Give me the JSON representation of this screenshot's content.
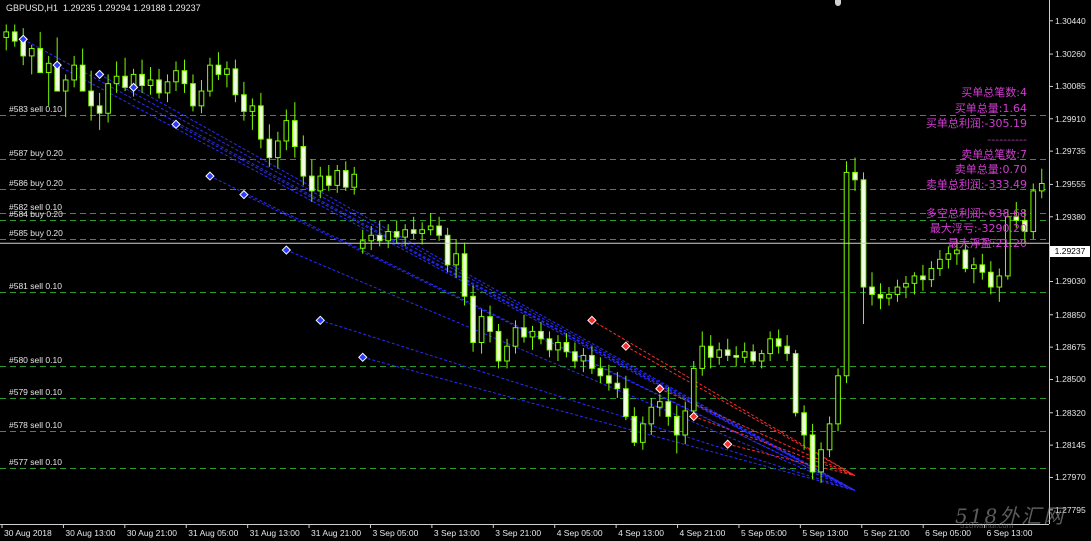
{
  "header": {
    "text": "GBPUSD,H1  1.29235 1.29294 1.29188 1.29237"
  },
  "price_axis": {
    "labels": [
      "1.30440",
      "1.30260",
      "1.30085",
      "1.29910",
      "1.29735",
      "1.29555",
      "1.29380",
      "1.29205",
      "1.29030",
      "1.28850",
      "1.28675",
      "1.28500",
      "1.28320",
      "1.28145",
      "1.27970",
      "1.27795"
    ],
    "current": "1.29237"
  },
  "time_axis": {
    "labels": [
      "30 Aug 2018",
      "30 Aug 13:00",
      "30 Aug 21:00",
      "31 Aug 05:00",
      "31 Aug 13:00",
      "31 Aug 21:00",
      "3 Sep 05:00",
      "3 Sep 13:00",
      "3 Sep 21:00",
      "4 Sep 05:00",
      "4 Sep 13:00",
      "4 Sep 21:00",
      "5 Sep 05:00",
      "5 Sep 13:00",
      "5 Sep 21:00",
      "6 Sep 05:00",
      "6 Sep 13:00"
    ]
  },
  "order_lines": [
    {
      "label": "#583 sell 0.10",
      "price": 1.2993
    },
    {
      "label": "#587 buy 0.20",
      "price": 1.29695
    },
    {
      "label": "#586 buy 0.20",
      "price": 1.2953
    },
    {
      "label": "#582 sell 0.10",
      "price": 1.294
    },
    {
      "label": "#584 buy 0.20",
      "price": 1.2936
    },
    {
      "label": "#585 buy 0.20",
      "price": 1.2926
    },
    {
      "label": "#581 sell 0.10",
      "price": 1.28975
    },
    {
      "label": "#580 sell 0.10",
      "price": 1.28575
    },
    {
      "label": "#579 sell 0.10",
      "price": 1.284
    },
    {
      "label": "#578 sell 0.10",
      "price": 1.2822
    },
    {
      "label": "#577 sell 0.10",
      "price": 1.2802
    }
  ],
  "stats": {
    "buy_count": "买单总笔数:4",
    "buy_volume": "买单总量:1.64",
    "buy_profit": "买单总利润:-305.19",
    "separator": "----------",
    "sell_count": "卖单总笔数:7",
    "sell_volume": "卖单总量:0.70",
    "sell_profit": "卖单总利润:-333.49",
    "net_profit": "多空总利润:-638.68",
    "max_floating_loss": "最大浮亏:-3290.20",
    "max_floating_profit": "最大浮盈:21.20"
  },
  "watermark": {
    "main": "518外汇网",
    "sub": "518waihui.com"
  },
  "colors": {
    "background": "#000000",
    "bull_candle": "#000000",
    "bull_outline": "#7cfc00",
    "bear_candle": "#f0ffe0",
    "order_line": "#2e9a2e",
    "stats_text": "#d23cd2",
    "buy_marker": "#2a3cff",
    "sell_marker": "#ff2a2a",
    "buy_link": "#2a2aff",
    "sell_link": "#ff2a2a"
  },
  "chart_data": {
    "type": "candlestick",
    "symbol": "GBPUSD",
    "timeframe": "H1",
    "ylim": [
      1.2774,
      1.3052
    ],
    "candles": [
      [
        1.3035,
        1.3042,
        1.3028,
        1.3038
      ],
      [
        1.3038,
        1.3042,
        1.303,
        1.3033
      ],
      [
        1.3033,
        1.304,
        1.302,
        1.3025
      ],
      [
        1.3025,
        1.3031,
        1.3015,
        1.3029
      ],
      [
        1.3029,
        1.3038,
        1.3022,
        1.3016
      ],
      [
        1.3016,
        1.3025,
        1.2998,
        1.3021
      ],
      [
        1.3021,
        1.3035,
        1.301,
        1.3006
      ],
      [
        1.3006,
        1.3015,
        1.2992,
        1.3012
      ],
      [
        1.3012,
        1.3025,
        1.3008,
        1.302
      ],
      [
        1.302,
        1.3029,
        1.3015,
        1.3006
      ],
      [
        1.3006,
        1.3017,
        1.299,
        1.2998
      ],
      [
        1.2998,
        1.3005,
        1.2985,
        1.2994
      ],
      [
        1.2994,
        1.3015,
        1.2989,
        1.301
      ],
      [
        1.301,
        1.3022,
        1.3005,
        1.3014
      ],
      [
        1.3014,
        1.3024,
        1.3006,
        1.3008
      ],
      [
        1.3008,
        1.3018,
        1.3003,
        1.3015
      ],
      [
        1.3015,
        1.3023,
        1.3005,
        1.3009
      ],
      [
        1.3009,
        1.3019,
        1.3004,
        1.3012
      ],
      [
        1.3012,
        1.3018,
        1.3002,
        1.3005
      ],
      [
        1.3005,
        1.3015,
        1.3,
        1.3011
      ],
      [
        1.3011,
        1.3022,
        1.3006,
        1.3017
      ],
      [
        1.3017,
        1.3023,
        1.3005,
        1.301
      ],
      [
        1.301,
        1.3015,
        1.2995,
        1.2998
      ],
      [
        1.2998,
        1.3012,
        1.2994,
        1.3006
      ],
      [
        1.3006,
        1.3024,
        1.3003,
        1.302
      ],
      [
        1.302,
        1.3027,
        1.3012,
        1.3015
      ],
      [
        1.3015,
        1.3022,
        1.3008,
        1.3018
      ],
      [
        1.3018,
        1.3023,
        1.3,
        1.3004
      ],
      [
        1.3004,
        1.3011,
        1.299,
        1.2995
      ],
      [
        1.2995,
        1.3002,
        1.2985,
        1.2998
      ],
      [
        1.2998,
        1.3005,
        1.2975,
        1.298
      ],
      [
        1.298,
        1.2988,
        1.2965,
        1.297
      ],
      [
        1.297,
        1.2984,
        1.2964,
        1.2979
      ],
      [
        1.2979,
        1.2996,
        1.2974,
        1.299
      ],
      [
        1.299,
        1.3,
        1.297,
        1.2976
      ],
      [
        1.2976,
        1.2982,
        1.2955,
        1.296
      ],
      [
        1.296,
        1.2969,
        1.2946,
        1.2952
      ],
      [
        1.2952,
        1.2965,
        1.2948,
        1.296
      ],
      [
        1.296,
        1.2966,
        1.2952,
        1.2955
      ],
      [
        1.2955,
        1.2966,
        1.2951,
        1.2963
      ],
      [
        1.2963,
        1.2968,
        1.2952,
        1.2954
      ],
      [
        1.2954,
        1.2965,
        1.295,
        1.2961
      ],
      [
        1.2921,
        1.2931,
        1.2918,
        1.2925
      ],
      [
        1.2925,
        1.2933,
        1.292,
        1.2928
      ],
      [
        1.2928,
        1.2936,
        1.2922,
        1.2925
      ],
      [
        1.2925,
        1.2934,
        1.2921,
        1.293
      ],
      [
        1.293,
        1.2936,
        1.2924,
        1.2927
      ],
      [
        1.2927,
        1.2934,
        1.2922,
        1.2931
      ],
      [
        1.2931,
        1.2938,
        1.2926,
        1.2929
      ],
      [
        1.2929,
        1.2935,
        1.2923,
        1.2931
      ],
      [
        1.2931,
        1.294,
        1.2928,
        1.2933
      ],
      [
        1.2933,
        1.2938,
        1.2925,
        1.2928
      ],
      [
        1.2928,
        1.2932,
        1.2908,
        1.2912
      ],
      [
        1.2912,
        1.2926,
        1.2905,
        1.2918
      ],
      [
        1.2918,
        1.2924,
        1.289,
        1.2895
      ],
      [
        1.2895,
        1.2901,
        1.2865,
        1.287
      ],
      [
        1.287,
        1.2888,
        1.2864,
        1.2884
      ],
      [
        1.2884,
        1.289,
        1.287,
        1.2876
      ],
      [
        1.2876,
        1.288,
        1.2856,
        1.286
      ],
      [
        1.286,
        1.2872,
        1.2856,
        1.2868
      ],
      [
        1.2868,
        1.2882,
        1.2864,
        1.2878
      ],
      [
        1.2878,
        1.2885,
        1.287,
        1.2873
      ],
      [
        1.2873,
        1.2879,
        1.2866,
        1.2876
      ],
      [
        1.2876,
        1.2881,
        1.2869,
        1.2872
      ],
      [
        1.2872,
        1.2876,
        1.2862,
        1.2866
      ],
      [
        1.2866,
        1.2874,
        1.286,
        1.287
      ],
      [
        1.287,
        1.2875,
        1.2862,
        1.2865
      ],
      [
        1.2865,
        1.287,
        1.2856,
        1.286
      ],
      [
        1.286,
        1.2867,
        1.2854,
        1.2863
      ],
      [
        1.2863,
        1.2868,
        1.2853,
        1.2856
      ],
      [
        1.2856,
        1.2862,
        1.2848,
        1.2852
      ],
      [
        1.2852,
        1.2858,
        1.2844,
        1.2848
      ],
      [
        1.2848,
        1.2854,
        1.284,
        1.2845
      ],
      [
        1.2845,
        1.2852,
        1.2828,
        1.283
      ],
      [
        1.283,
        1.2835,
        1.2814,
        1.2816
      ],
      [
        1.2816,
        1.283,
        1.2812,
        1.2826
      ],
      [
        1.2826,
        1.284,
        1.282,
        1.2835
      ],
      [
        1.2835,
        1.2842,
        1.283,
        1.2838
      ],
      [
        1.2838,
        1.2846,
        1.2825,
        1.283
      ],
      [
        1.283,
        1.2836,
        1.281,
        1.282
      ],
      [
        1.282,
        1.2838,
        1.2815,
        1.2833
      ],
      [
        1.2833,
        1.286,
        1.2829,
        1.2856
      ],
      [
        1.2856,
        1.2876,
        1.2852,
        1.2868
      ],
      [
        1.2868,
        1.2874,
        1.2856,
        1.2862
      ],
      [
        1.2862,
        1.287,
        1.2858,
        1.2866
      ],
      [
        1.2866,
        1.2872,
        1.286,
        1.2863
      ],
      [
        1.2863,
        1.2868,
        1.2857,
        1.2862
      ],
      [
        1.2862,
        1.287,
        1.2859,
        1.2865
      ],
      [
        1.2865,
        1.2869,
        1.2858,
        1.286
      ],
      [
        1.286,
        1.2866,
        1.2856,
        1.2864
      ],
      [
        1.2864,
        1.2876,
        1.286,
        1.2872
      ],
      [
        1.2872,
        1.2877,
        1.2864,
        1.2868
      ],
      [
        1.2868,
        1.2874,
        1.286,
        1.2864
      ],
      [
        1.2864,
        1.2866,
        1.283,
        1.2832
      ],
      [
        1.2832,
        1.2836,
        1.2812,
        1.282
      ],
      [
        1.282,
        1.2826,
        1.2796,
        1.28
      ],
      [
        1.28,
        1.2816,
        1.2794,
        1.2812
      ],
      [
        1.2812,
        1.283,
        1.2808,
        1.2826
      ],
      [
        1.2826,
        1.2856,
        1.2822,
        1.2852
      ],
      [
        1.2852,
        1.2968,
        1.2848,
        1.2962
      ],
      [
        1.2962,
        1.297,
        1.2952,
        1.2958
      ],
      [
        1.2958,
        1.2962,
        1.288,
        1.29
      ],
      [
        1.29,
        1.2908,
        1.289,
        1.2896
      ],
      [
        1.2896,
        1.2902,
        1.2888,
        1.2894
      ],
      [
        1.2894,
        1.29,
        1.289,
        1.2896
      ],
      [
        1.2896,
        1.2904,
        1.2892,
        1.29
      ],
      [
        1.29,
        1.2906,
        1.2894,
        1.2902
      ],
      [
        1.2902,
        1.2908,
        1.2896,
        1.2906
      ],
      [
        1.2906,
        1.2912,
        1.2898,
        1.2904
      ],
      [
        1.2904,
        1.2914,
        1.29,
        1.291
      ],
      [
        1.291,
        1.292,
        1.2906,
        1.2915
      ],
      [
        1.2915,
        1.2922,
        1.291,
        1.2918
      ],
      [
        1.2918,
        1.2926,
        1.2912,
        1.292
      ],
      [
        1.292,
        1.2924,
        1.2908,
        1.291
      ],
      [
        1.291,
        1.2916,
        1.2902,
        1.2912
      ],
      [
        1.2912,
        1.2918,
        1.2904,
        1.2908
      ],
      [
        1.2908,
        1.2914,
        1.2896,
        1.29
      ],
      [
        1.29,
        1.291,
        1.2892,
        1.2906
      ],
      [
        1.2906,
        1.2942,
        1.2904,
        1.2938
      ],
      [
        1.2938,
        1.2946,
        1.2932,
        1.2936
      ],
      [
        1.2936,
        1.2942,
        1.2924,
        1.293
      ],
      [
        1.293,
        1.2956,
        1.2926,
        1.2952
      ],
      [
        1.2952,
        1.2964,
        1.2948,
        1.2956
      ]
    ],
    "trade_markers": [
      {
        "side": "buy",
        "open": 1.3034,
        "close": 1.279
      },
      {
        "side": "buy",
        "open": 1.302,
        "close": 1.279
      },
      {
        "side": "buy",
        "open": 1.3015,
        "close": 1.279
      },
      {
        "side": "buy",
        "open": 1.3008,
        "close": 1.279
      },
      {
        "side": "buy",
        "open": 1.2988,
        "close": 1.279
      },
      {
        "side": "buy",
        "open": 1.296,
        "close": 1.279
      },
      {
        "side": "buy",
        "open": 1.295,
        "close": 1.279
      },
      {
        "side": "buy",
        "open": 1.292,
        "close": 1.279
      },
      {
        "side": "buy",
        "open": 1.2882,
        "close": 1.279
      },
      {
        "side": "buy",
        "open": 1.2862,
        "close": 1.279
      },
      {
        "side": "sell",
        "open": 1.2882,
        "close": 1.2798
      },
      {
        "side": "sell",
        "open": 1.2868,
        "close": 1.2798
      },
      {
        "side": "sell",
        "open": 1.2845,
        "close": 1.2798
      },
      {
        "side": "sell",
        "open": 1.283,
        "close": 1.2798
      },
      {
        "side": "sell",
        "open": 1.2815,
        "close": 1.2798
      }
    ]
  }
}
